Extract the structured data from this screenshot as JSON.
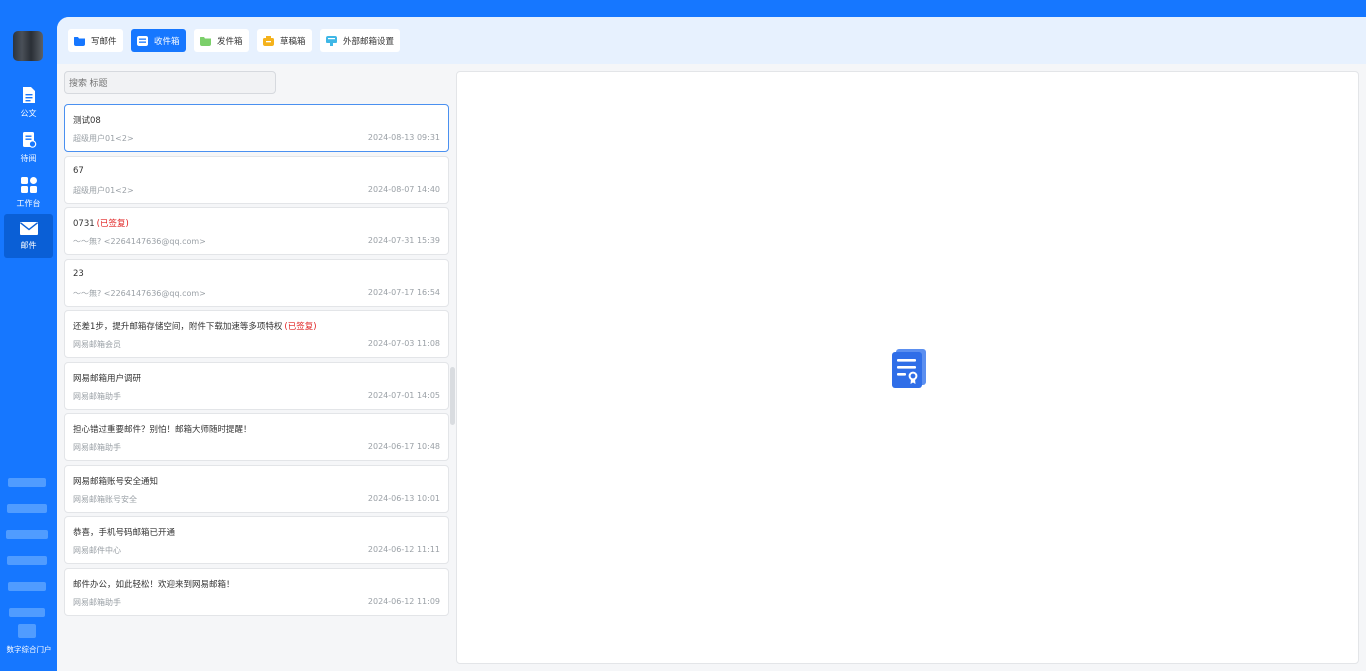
{
  "sidebar": {
    "items": [
      {
        "label": "公文",
        "icon": "document-icon"
      },
      {
        "label": "待阅",
        "icon": "pending-read-icon"
      },
      {
        "label": "工作台",
        "icon": "workbench-icon"
      },
      {
        "label": "邮件",
        "icon": "mail-icon",
        "active": true
      }
    ],
    "portal_label": "数字综合门户"
  },
  "toolbar": {
    "compose": "写邮件",
    "inbox": "收件箱",
    "sent": "发件箱",
    "drafts": "草稿箱",
    "external_settings": "外部邮箱设置"
  },
  "search": {
    "placeholder": "搜索 标题"
  },
  "mails": [
    {
      "subject": "测试08",
      "replied": "",
      "sender": "超级用户01<2>",
      "time": "2024-08-13 09:31"
    },
    {
      "subject": "67",
      "replied": "",
      "sender": "超级用户01<2>",
      "time": "2024-08-07 14:40"
    },
    {
      "subject": "0731",
      "replied": "(已签复)",
      "sender": "～～無?  <2264147636@qq.com>",
      "time": "2024-07-31 15:39"
    },
    {
      "subject": "23",
      "replied": "",
      "sender": "～～無?  <2264147636@qq.com>",
      "time": "2024-07-17 16:54"
    },
    {
      "subject": "还差1步，提升邮箱存储空间，附件下载加速等多项特权",
      "replied": "(已签复)",
      "sender": "网易邮箱会员",
      "time": "2024-07-03 11:08"
    },
    {
      "subject": "网易邮箱用户调研",
      "replied": "",
      "sender": "网易邮箱助手",
      "time": "2024-07-01 14:05"
    },
    {
      "subject": "担心错过重要邮件？别怕！邮箱大师随时提醒！",
      "replied": "",
      "sender": "网易邮箱助手",
      "time": "2024-06-17 10:48"
    },
    {
      "subject": "网易邮箱账号安全通知",
      "replied": "",
      "sender": "网易邮箱账号安全",
      "time": "2024-06-13 10:01"
    },
    {
      "subject": "恭喜，手机号码邮箱已开通",
      "replied": "",
      "sender": "网易邮件中心",
      "time": "2024-06-12 11:11"
    },
    {
      "subject": "邮件办公，如此轻松！欢迎来到网易邮箱！",
      "replied": "",
      "sender": "网易邮箱助手",
      "time": "2024-06-12 11:09"
    }
  ],
  "colors": {
    "primary": "#1677ff",
    "replied": "#e02020"
  }
}
